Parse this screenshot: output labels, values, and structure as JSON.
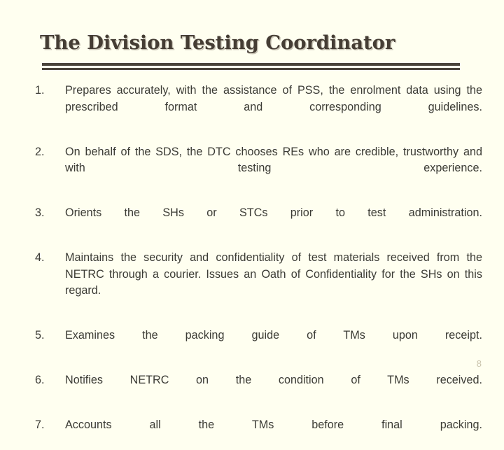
{
  "slide": {
    "background_color": "#FFFFF0",
    "title": "The Division Testing Coordinator",
    "title_color": "#453D34",
    "divider_color": "#4A443B",
    "body_text_color": "#3B3B35",
    "page_number": "8",
    "page_number_color": "#C9C3AC"
  },
  "content": {
    "items": [
      {
        "number": "1.",
        "text": "Prepares accurately, with the assistance of PSS, the enrolment data using the prescribed format and corresponding guidelines."
      },
      {
        "number": "2.",
        "text": "On behalf of the SDS, the DTC chooses REs who are credible, trustworthy and with testing experience."
      },
      {
        "number": "3.",
        "text": "Orients the SHs or STCs prior to test administration."
      },
      {
        "number": "4.",
        "text": "Maintains the security and confidentiality of test materials received from the NETRC through a courier. Issues an Oath of Confidentiality for the SHs on this regard."
      },
      {
        "number": "5.",
        "text": "Examines the packing guide of  TMs upon receipt."
      },
      {
        "number": "6.",
        "text": "Notifies NETRC on the condition of TMs received."
      },
      {
        "number": "7.",
        "text": "Accounts all the TMs before final packing."
      }
    ]
  }
}
